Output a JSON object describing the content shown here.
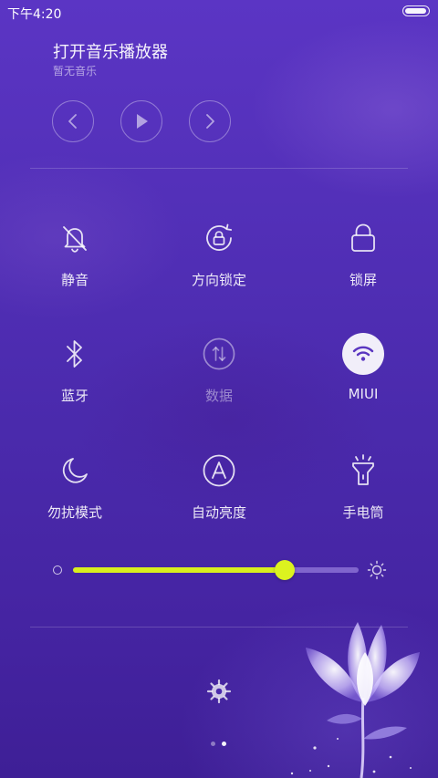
{
  "status_bar": {
    "time": "下午4:20",
    "battery_level": 0.95
  },
  "music": {
    "title": "打开音乐播放器",
    "subtitle": "暂无音乐",
    "controls": [
      {
        "name": "previous",
        "icon": "chevron-left-icon"
      },
      {
        "name": "play",
        "icon": "play-icon"
      },
      {
        "name": "next",
        "icon": "chevron-right-icon"
      }
    ]
  },
  "toggles": [
    {
      "label": "静音",
      "icon": "bell-off-icon",
      "state": "off"
    },
    {
      "label": "方向锁定",
      "icon": "rotation-lock-icon",
      "state": "off"
    },
    {
      "label": "锁屏",
      "icon": "lock-icon",
      "state": "off"
    },
    {
      "label": "蓝牙",
      "icon": "bluetooth-icon",
      "state": "off"
    },
    {
      "label": "数据",
      "icon": "mobile-data-icon",
      "state": "disabled"
    },
    {
      "label": "MIUI",
      "icon": "wifi-icon",
      "state": "on"
    },
    {
      "label": "勿扰模式",
      "icon": "moon-icon",
      "state": "off"
    },
    {
      "label": "自动亮度",
      "icon": "auto-brightness-icon",
      "state": "off"
    },
    {
      "label": "手电筒",
      "icon": "flashlight-icon",
      "state": "off"
    }
  ],
  "brightness": {
    "level": 0.74
  },
  "settings": {
    "icon": "gear-icon"
  },
  "pager": {
    "count": 2,
    "current": 2
  },
  "colors": {
    "background": "#5330b9",
    "slider_accent": "#d9ef1e",
    "active_toggle_bg": "#ffffff",
    "active_icon": "#5a35c0"
  }
}
